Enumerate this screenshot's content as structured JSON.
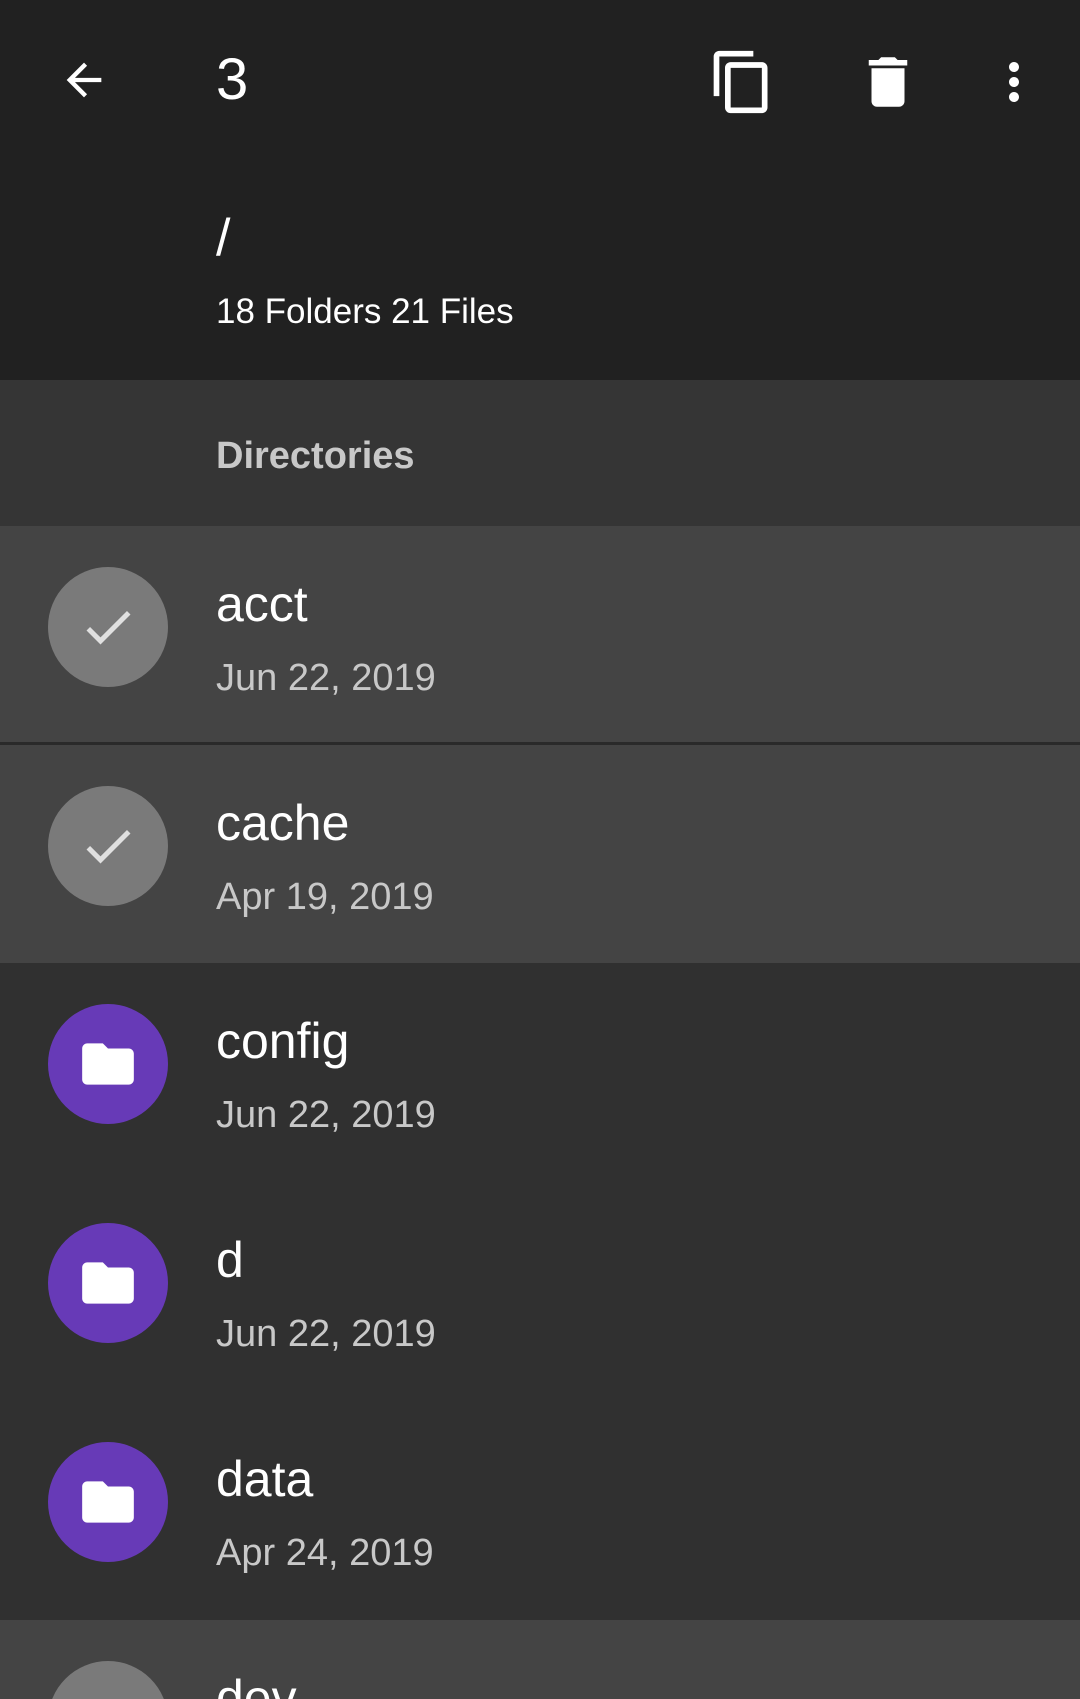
{
  "toolbar": {
    "selected_count": "3",
    "back_icon": "arrow-left-icon",
    "copy_icon": "copy-icon",
    "delete_icon": "trash-icon",
    "more_icon": "more-vert-icon"
  },
  "path": {
    "title": "/",
    "summary": "18 Folders 21 Files"
  },
  "section": {
    "label": "Directories"
  },
  "items": [
    {
      "name": "acct",
      "date": "Jun 22, 2019",
      "selected": true
    },
    {
      "name": "cache",
      "date": "Apr 19, 2019",
      "selected": true
    },
    {
      "name": "config",
      "date": "Jun 22, 2019",
      "selected": false
    },
    {
      "name": "d",
      "date": "Jun 22, 2019",
      "selected": false
    },
    {
      "name": "data",
      "date": "Apr 24, 2019",
      "selected": false
    },
    {
      "name": "dev",
      "date": "",
      "selected": true
    }
  ],
  "colors": {
    "appbar": "#212121",
    "background": "#303030",
    "selected_row": "#444444",
    "folder_accent": "#673ab7",
    "check_avatar": "#7a7a7a"
  }
}
